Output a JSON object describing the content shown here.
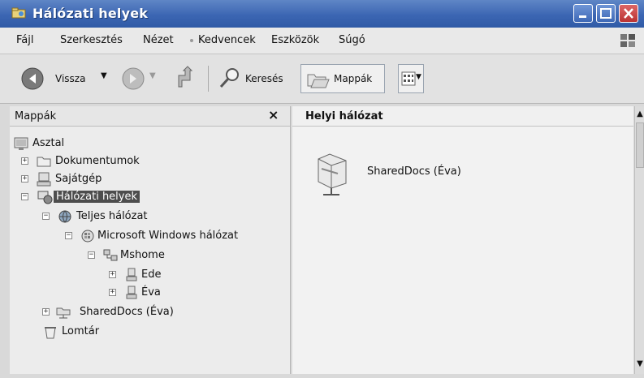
{
  "window": {
    "title": "Hálózati helyek"
  },
  "menu": {
    "items": [
      "Fájl",
      "Szerkesztés",
      "Nézet",
      "Kedvencek",
      "Eszközök",
      "Súgó"
    ]
  },
  "toolbar": {
    "back_label": "Vissza",
    "search_label": "Keresés",
    "folders_label": "Mappák"
  },
  "left_pane": {
    "title": "Mappák",
    "close_glyph": "×",
    "tree": [
      {
        "label": "Asztal",
        "icon": "desktop-icon",
        "expander": ""
      },
      {
        "label": "Dokumentumok",
        "icon": "documents-folder-icon",
        "expander": "+"
      },
      {
        "label": "Sajátgép",
        "icon": "my-computer-icon",
        "expander": "+"
      },
      {
        "label": "Hálózati helyek",
        "icon": "network-places-icon",
        "expander": "−",
        "selected": true
      },
      {
        "label": "Teljes hálózat",
        "icon": "globe-icon",
        "expander": "−"
      },
      {
        "label": "Microsoft Windows hálózat",
        "icon": "windows-network-icon",
        "expander": "−"
      },
      {
        "label": "Mshome",
        "icon": "workgroup-icon",
        "expander": "−"
      },
      {
        "label": "Ede",
        "icon": "computer-icon",
        "expander": "+"
      },
      {
        "label": "Éva",
        "icon": "computer-icon",
        "expander": "+"
      },
      {
        "label": "SharedDocs (Éva)",
        "icon": "network-share-icon",
        "expander": "+"
      },
      {
        "label": "Lomtár",
        "icon": "recycle-bin-icon",
        "expander": ""
      }
    ]
  },
  "right_pane": {
    "group_title": "Helyi hálózat",
    "items": [
      {
        "label": "SharedDocs (Éva)",
        "icon": "network-share-icon"
      }
    ]
  },
  "colors": {
    "titlebar": "#3c66b3",
    "selection": "#4d4d4d"
  }
}
